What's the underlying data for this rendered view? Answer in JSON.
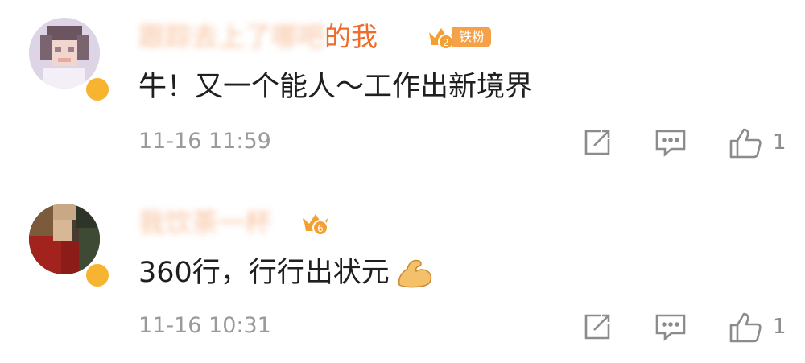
{
  "comments": [
    {
      "username_blurred": "跟踪去上了哪吧",
      "username_visible": "的我",
      "fan_badge_level": "2",
      "fan_badge_label": "铁粉",
      "text": "牛！又一个能人～工作出新境界",
      "timestamp": "11-16 11:59",
      "like_count": "1",
      "icons": [
        "repost-icon",
        "comment-icon",
        "like-icon"
      ]
    },
    {
      "username_blurred": "我饮茶一杯",
      "username_visible": "",
      "fan_badge_level": "6",
      "fan_badge_label": "",
      "text": "360行，行行出状元",
      "emoji": "flexed-biceps-icon",
      "timestamp": "11-16 10:31",
      "like_count": "1",
      "icons": [
        "repost-icon",
        "comment-icon",
        "like-icon"
      ]
    }
  ],
  "colors": {
    "username": "#f28b47",
    "badge": "#f4a14a",
    "meta": "#9a9a9a",
    "text": "#1f1f1f"
  }
}
